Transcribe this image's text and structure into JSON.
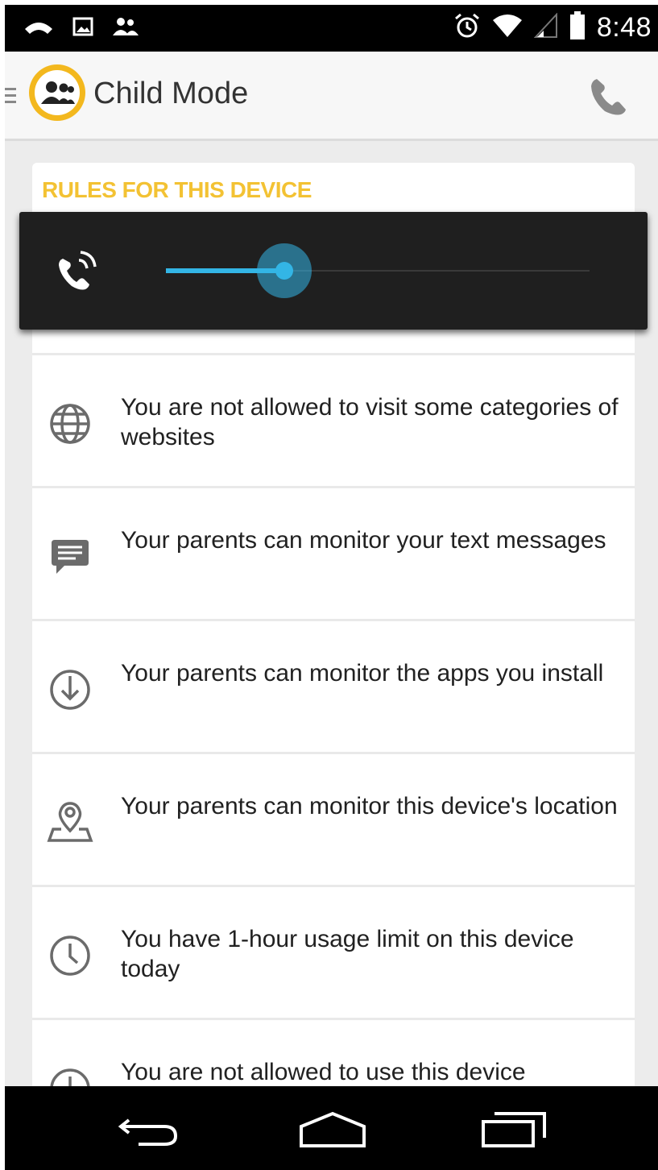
{
  "status_bar": {
    "time": "8:48",
    "icons": [
      "missed-call-icon",
      "image-icon",
      "people-icon",
      "alarm-icon",
      "wifi-icon",
      "signal-icon",
      "battery-icon"
    ]
  },
  "action_bar": {
    "title": "Child Mode",
    "icons": [
      "menu-icon",
      "child-mode-logo",
      "phone-icon"
    ]
  },
  "rules_section": {
    "header": "RULES FOR THIS DEVICE",
    "items": [
      {
        "icon": "globe-icon",
        "text": "You are not allowed to visit some categories of websites"
      },
      {
        "icon": "message-icon",
        "text": "Your parents can monitor your text messages"
      },
      {
        "icon": "download-icon",
        "text": "Your parents can monitor the apps you install"
      },
      {
        "icon": "location-icon",
        "text": "Your parents can monitor this device's location"
      },
      {
        "icon": "clock-icon",
        "text": "You have 1-hour usage limit on this device today"
      },
      {
        "icon": "clock-icon",
        "text": "You are not allowed to use this device"
      }
    ]
  },
  "volume_overlay": {
    "icon": "call-volume-icon",
    "level": 0.28
  },
  "nav_bar": {
    "icons": [
      "back-icon",
      "home-icon",
      "recents-icon"
    ]
  },
  "colors": {
    "accent_yellow": "#f3c233",
    "logo_ring": "#f3b81e",
    "slider_blue": "#33b5e5",
    "overlay_bg": "#1f1f1f"
  }
}
